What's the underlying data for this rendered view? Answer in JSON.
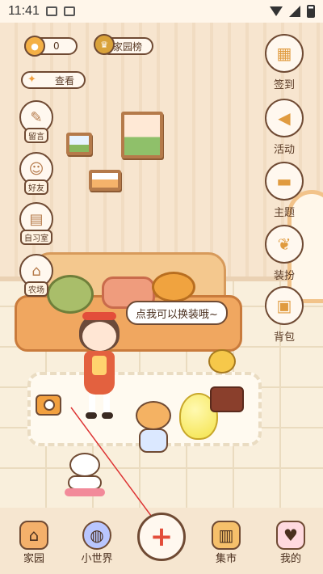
{
  "status_bar": {
    "time": "11:41"
  },
  "hud": {
    "coins_value": "0",
    "ranking_label": "家园榜",
    "view_label": "查看"
  },
  "left_menu": [
    {
      "label": "留言",
      "icon": "notepad-icon"
    },
    {
      "label": "好友",
      "icon": "friends-icon"
    },
    {
      "label": "自习室",
      "icon": "desk-icon"
    },
    {
      "label": "农场",
      "icon": "farm-icon"
    }
  ],
  "right_menu": [
    {
      "label": "签到",
      "icon": "calendar-icon"
    },
    {
      "label": "活动",
      "icon": "megaphone-icon"
    },
    {
      "label": "主题",
      "icon": "paint-roller-icon"
    },
    {
      "label": "装扮",
      "icon": "bow-icon"
    },
    {
      "label": "背包",
      "icon": "backpack-icon"
    }
  ],
  "speech_bubble": "点我可以换装哦~",
  "bottom_nav": [
    {
      "label": "家园",
      "icon": "house-icon"
    },
    {
      "label": "小世界",
      "icon": "planet-icon"
    },
    {
      "label": "集市",
      "icon": "shop-icon"
    },
    {
      "label": "我的",
      "icon": "profile-card-icon"
    }
  ],
  "colors": {
    "accent": "#e34d3a",
    "outline": "#6f4a33"
  }
}
